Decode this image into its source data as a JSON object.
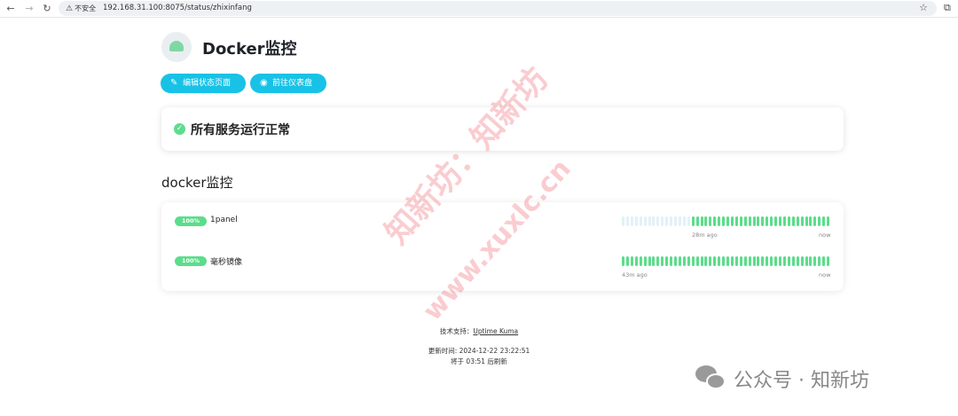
{
  "browser": {
    "insecure_label": "不安全",
    "url": "192.168.31.100:8075/status/zhixinfang"
  },
  "page": {
    "title": "Docker监控",
    "edit_button": "编辑状态页面",
    "dashboard_button": "前往仪表盘",
    "overall_status": "所有服务运行正常",
    "group_title": "docker监控"
  },
  "monitors": [
    {
      "name": "1panel",
      "uptime": "100%",
      "start_label": "28m ago",
      "end_label": "now",
      "empty_beats": 16,
      "up_beats": 32
    },
    {
      "name": "毫秒镜像",
      "uptime": "100%",
      "start_label": "43m ago",
      "end_label": "now",
      "empty_beats": 0,
      "up_beats": 48
    }
  ],
  "footer": {
    "powered_prefix": "技术支持：",
    "powered_link": "Uptime Kuma",
    "updated": "更新时间: 2024-12-22 23:22:51",
    "refresh": "将于 03:51 后刷新"
  },
  "watermark": {
    "line1": "知新坊：知新坊",
    "line2": "www.xuxlc.cn"
  },
  "brand": {
    "text": "公众号 · 知新坊"
  },
  "colors": {
    "accent": "#18c2e6",
    "up": "#5cdd8b",
    "empty": "#e3f1f7"
  }
}
